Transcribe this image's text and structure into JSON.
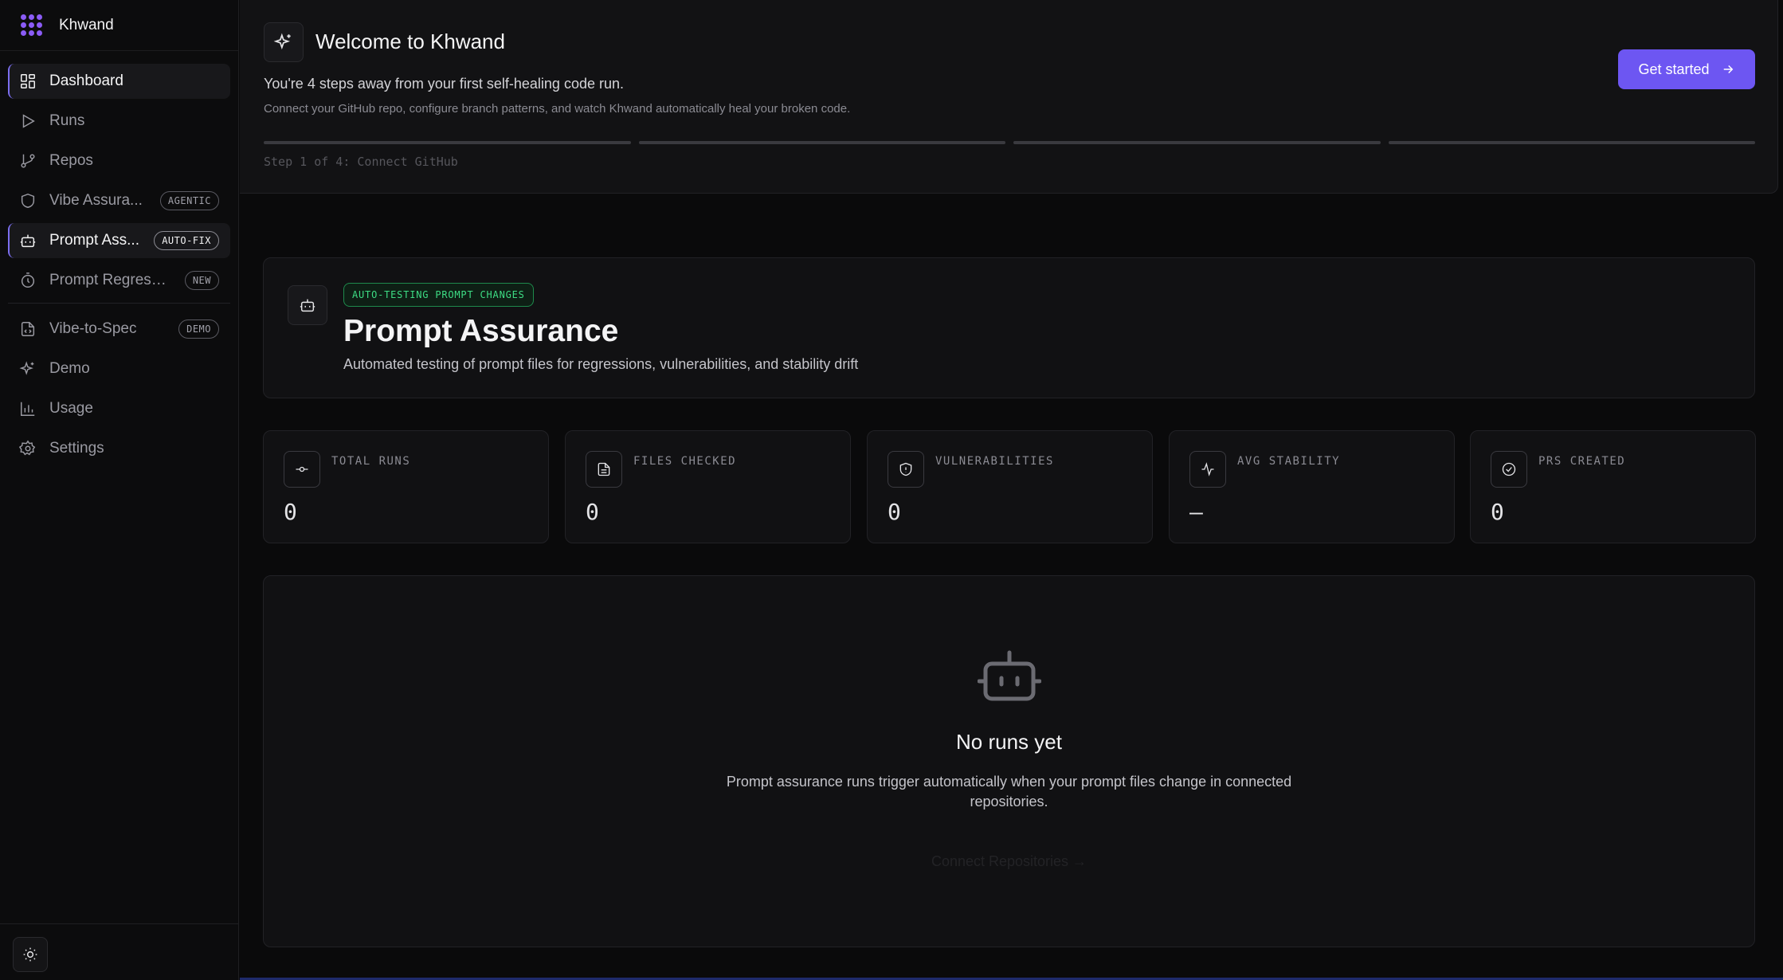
{
  "brand": {
    "name": "Khwand"
  },
  "sidebar": {
    "items": [
      {
        "label": "Dashboard",
        "icon": "dashboard-icon",
        "active": true,
        "badge": ""
      },
      {
        "label": "Runs",
        "icon": "play-icon",
        "badge": ""
      },
      {
        "label": "Repos",
        "icon": "git-branch-icon",
        "badge": ""
      },
      {
        "label": "Vibe Assura...",
        "icon": "shield-icon",
        "badge": "AGENTIC"
      },
      {
        "label": "Prompt Ass...",
        "icon": "bot-icon",
        "badge": "AUTO-FIX"
      },
      {
        "label": "Prompt Regressi...",
        "icon": "timer-icon",
        "badge": "NEW"
      },
      {
        "label": "Vibe-to-Spec",
        "icon": "file-code-icon",
        "badge": "DEMO"
      },
      {
        "label": "Demo",
        "icon": "sparkles-icon",
        "badge": ""
      },
      {
        "label": "Usage",
        "icon": "bar-chart-icon",
        "badge": ""
      },
      {
        "label": "Settings",
        "icon": "gear-icon",
        "badge": ""
      }
    ]
  },
  "welcome": {
    "title": "Welcome to Khwand",
    "subtitle": "You're 4 steps away from your first self-healing code run.",
    "description": "Connect your GitHub repo, configure branch patterns, and watch Khwand automatically heal your broken code.",
    "step_label": "Step 1 of 4: Connect GitHub",
    "button": "Get started"
  },
  "hero": {
    "tag": "AUTO-TESTING PROMPT CHANGES",
    "title": "Prompt Assurance",
    "description": "Automated testing of prompt files for regressions, vulnerabilities, and stability drift"
  },
  "stats": [
    {
      "label": "TOTAL RUNS",
      "value": "0",
      "icon": "git-commit-icon"
    },
    {
      "label": "FILES CHECKED",
      "value": "0",
      "icon": "file-text-icon"
    },
    {
      "label": "VULNERABILITIES",
      "value": "0",
      "icon": "shield-alert-icon"
    },
    {
      "label": "AVG STABILITY",
      "value": "—",
      "icon": "activity-icon"
    },
    {
      "label": "PRS CREATED",
      "value": "0",
      "icon": "check-circle-icon"
    }
  ],
  "empty": {
    "title": "No runs yet",
    "description": "Prompt assurance runs trigger automatically when your prompt files change in connected repositories.",
    "link": "Connect Repositories →"
  },
  "colors": {
    "accent": "#6d56f2",
    "tag_green": "#3ddc84",
    "background": "#0a0a0b"
  }
}
